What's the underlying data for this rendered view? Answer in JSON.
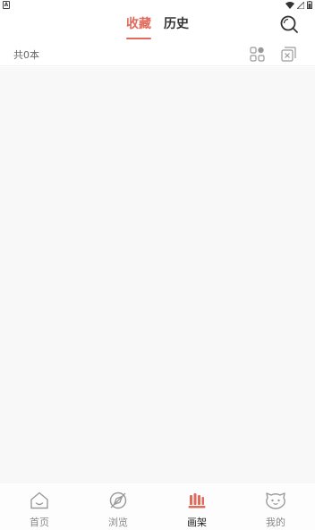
{
  "status_bar": {
    "left_icon": "A",
    "icons": [
      "wifi-icon",
      "signal-icon",
      "battery-icon"
    ]
  },
  "header": {
    "tabs": [
      {
        "label": "收藏",
        "active": true
      },
      {
        "label": "历史",
        "active": false
      }
    ],
    "search_icon": "search-icon"
  },
  "subbar": {
    "count_text": "共0本",
    "icons": [
      "grid-view-icon",
      "multi-select-icon"
    ]
  },
  "bottom_nav": {
    "items": [
      {
        "label": "首页",
        "icon": "home-icon",
        "active": false
      },
      {
        "label": "浏览",
        "icon": "browse-icon",
        "active": false
      },
      {
        "label": "画架",
        "icon": "bookshelf-icon",
        "active": true
      },
      {
        "label": "我的",
        "icon": "profile-icon",
        "active": false
      }
    ]
  },
  "colors": {
    "accent": "#e06b5c",
    "background": "#f8f8f8",
    "icon_gray": "#9a9a9a"
  }
}
